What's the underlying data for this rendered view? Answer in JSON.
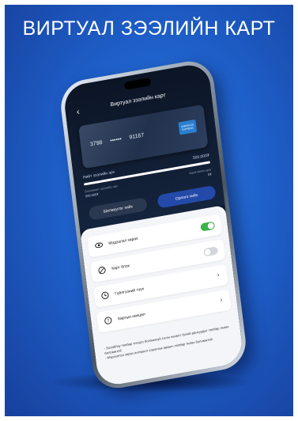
{
  "headline": "ВИРТУАЛ ЗЭЭЛИЙН КАРТ",
  "phone": {
    "nav": {
      "back_icon": "chevron-left-icon",
      "title": "Виртуал зээлийн карт"
    },
    "card": {
      "number_start": "3798",
      "number_mask": "••••••",
      "number_end": "91167",
      "logo_text": "AMERICAN EXPRESS"
    },
    "limit": {
      "label": "Нийт зээлийн эрх",
      "value": "500,000₮",
      "fill_percent": 100
    },
    "available": {
      "left_label": "Боломжит зээлийн эрх",
      "left_value": "500,000₮",
      "right_label": "Ашигласан дүн",
      "right_value": "0₮"
    },
    "buttons": {
      "transfer": "Шилжүүлэг хийх",
      "topup": "Орлого хийх"
    },
    "menu": [
      {
        "icon": "eye-icon",
        "label": "Мэдээлэл харах",
        "toggle": "on"
      },
      {
        "icon": "block-icon",
        "label": "Карт блок",
        "toggle": "off"
      },
      {
        "icon": "clock-icon",
        "label": "Гүйлгээний түүх"
      },
      {
        "icon": "help-icon",
        "label": "Картын нөхцөл"
      }
    ],
    "note": "- SocialPay төлбөр тооцоо боломжгүй гэсэн нөхөлт бүхий дансуудыг төлбөр төлөх боломжтой\n- Мэдээллээ харах интернэт хэрэглэж аваагч төлбөр төлөх боломжтой"
  },
  "colors": {
    "background": "#1e5fc9",
    "toggle_on": "#3cb24a",
    "topup_button": "#234aa8"
  }
}
